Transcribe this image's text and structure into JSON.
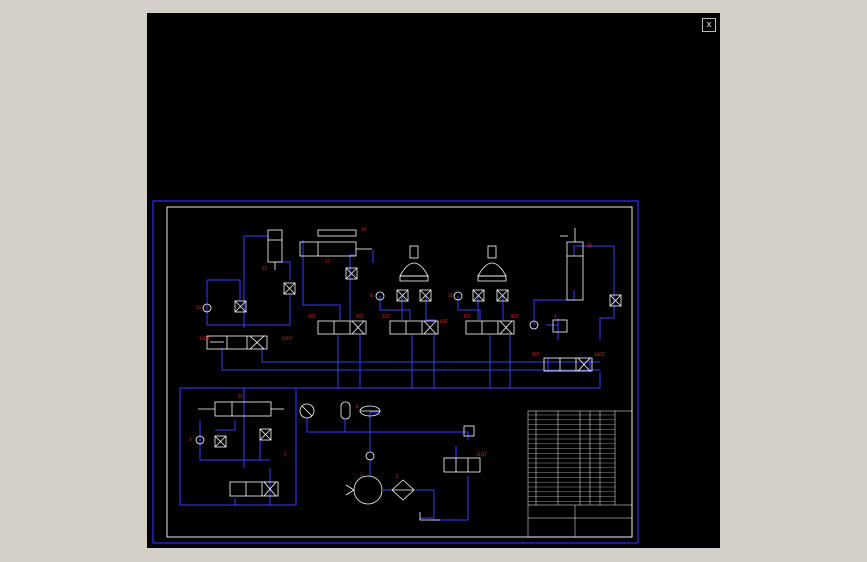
{
  "viewport": {
    "close_glyph": "x",
    "close_icon": "close-icon"
  },
  "colors": {
    "background": "#000000",
    "frame": "#2b2bff",
    "lines": "#3a3aff",
    "symbols": "#ffffff",
    "labels": "#ff2020",
    "outer_margin": "#d4d0c8"
  },
  "labels": {
    "l_1_cyl": "15",
    "l_2_cyl": "37",
    "l_3_cyl": "19",
    "l_4_cyl": "25",
    "l_5_check": "10",
    "l_6_check": "8",
    "l_7_check": "11",
    "l_8_check": "4",
    "l_9_v1": "1YDT",
    "l_10_v1": "2YDT",
    "l_11_v2": "3DT",
    "l_12_v2": "4DT",
    "l_13_v3": "5DT",
    "l_14_v3": "6DT",
    "l_15_v4": "7DT",
    "l_16_v4": "8DT",
    "l_17_v5": "9DT",
    "l_18_v5": "10DT",
    "l_19_b1": "31",
    "l_20_b2": "5",
    "l_21_b3": "3",
    "l_22_pump": "1",
    "l_23_filter": "2",
    "l_24_relief": "6",
    "l_25_valve": "11DT"
  }
}
